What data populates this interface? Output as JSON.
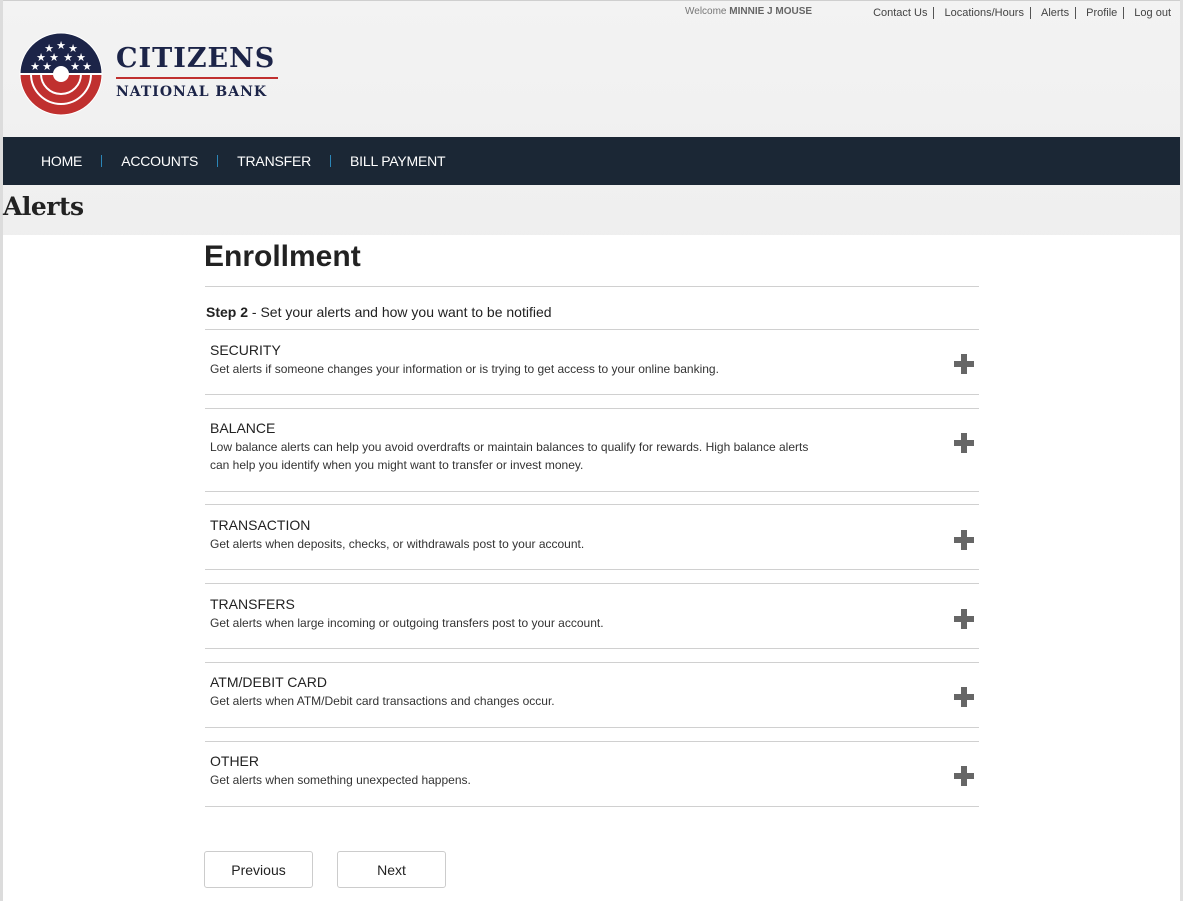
{
  "header": {
    "welcome_prefix": "Welcome",
    "user_name": "MINNIE J MOUSE",
    "util_links": [
      "Contact Us",
      "Locations/Hours",
      "Alerts",
      "Profile",
      "Log out"
    ],
    "logo": {
      "title": "CITIZENS",
      "subtitle": "NATIONAL BANK",
      "colors": {
        "navy": "#1c2448",
        "red": "#c0302f"
      }
    }
  },
  "nav": {
    "items": [
      "HOME",
      "ACCOUNTS",
      "TRANSFER",
      "BILL PAYMENT"
    ],
    "background": "#1b2735",
    "separator_color": "#2b86b8"
  },
  "page": {
    "title": "Alerts",
    "heading": "Enrollment",
    "step_label": "Step 2",
    "step_text": " - Set your alerts and how you want to be notified"
  },
  "sections": [
    {
      "title": "SECURITY",
      "description": "Get alerts if someone changes your information or is trying to get access to your online banking.",
      "icon": "plus-icon"
    },
    {
      "title": "BALANCE",
      "description": "Low balance alerts can help you avoid overdrafts or maintain balances to qualify for rewards. High balance alerts can help you identify when you might want to transfer or invest money.",
      "icon": "plus-icon"
    },
    {
      "title": "TRANSACTION",
      "description": "Get alerts when deposits, checks, or withdrawals post to your account.",
      "icon": "plus-icon"
    },
    {
      "title": "TRANSFERS",
      "description": "Get alerts when large incoming or outgoing transfers post to your account.",
      "icon": "plus-icon"
    },
    {
      "title": "ATM/DEBIT CARD",
      "description": "Get alerts when ATM/Debit card transactions and changes occur.",
      "icon": "plus-icon"
    },
    {
      "title": "OTHER",
      "description": "Get alerts when something unexpected happens.",
      "icon": "plus-icon"
    }
  ],
  "buttons": {
    "previous": "Previous",
    "next": "Next"
  }
}
